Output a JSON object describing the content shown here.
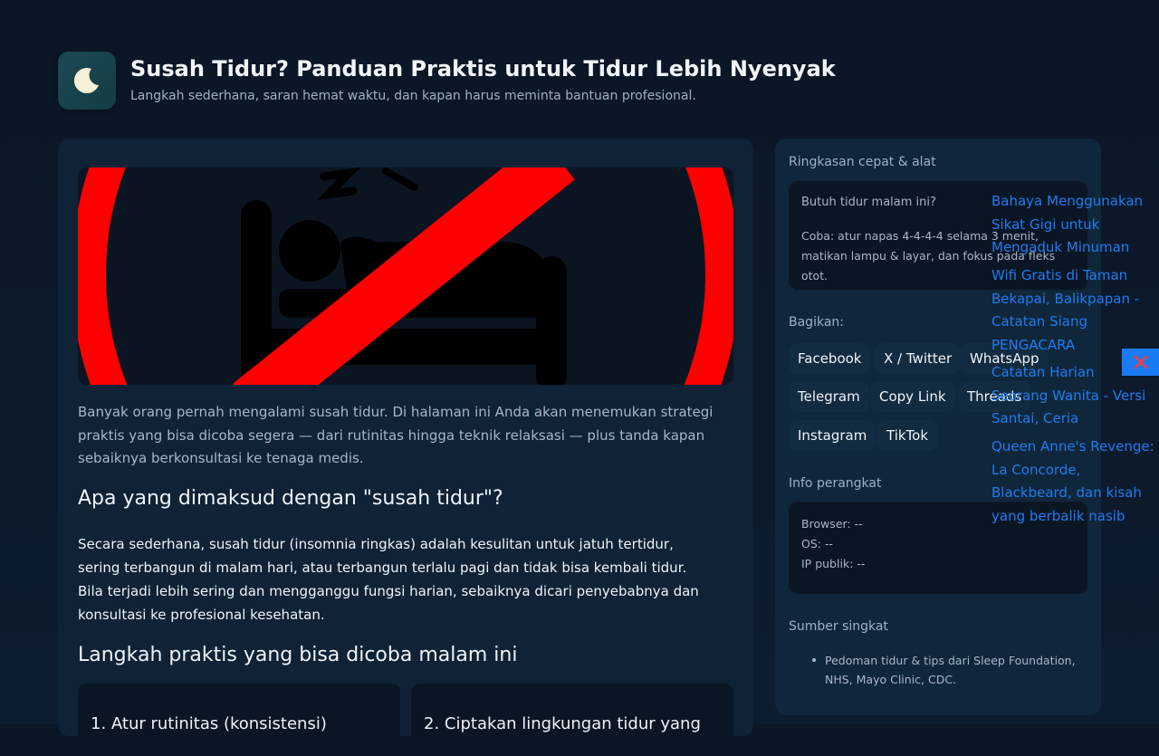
{
  "header": {
    "icon": "moon-icon",
    "title": "Susah Tidur? Panduan Praktis untuk Tidur Lebih Nyenyak",
    "subtitle": "Langkah sederhana, saran hemat waktu, dan kapan harus meminta bantuan profesional."
  },
  "hero": {
    "icon": "no-sleep-icon",
    "color": "#ff0000"
  },
  "article": {
    "intro": "Banyak orang pernah mengalami susah tidur. Di halaman ini Anda akan menemukan strategi praktis yang bisa dicoba segera — dari rutinitas hingga teknik relaksasi — plus tanda kapan sebaiknya berkonsultasi ke tenaga medis.",
    "h_definition": "Apa yang dimaksud dengan \"susah tidur\"?",
    "definition": "Secara sederhana, susah tidur (insomnia ringkas) adalah kesulitan untuk jatuh tertidur, sering terbangun di malam hari, atau terbangun terlalu pagi dan tidak bisa kembali tidur. Bila terjadi lebih sering dan mengganggu fungsi harian, sebaiknya dicari penyebabnya dan konsultasi ke profesional kesehatan.",
    "h_steps": "Langkah praktis yang bisa dicoba malam ini",
    "steps": [
      "1. Atur rutinitas (konsistensi)",
      "2. Ciptakan lingkungan tidur yang"
    ]
  },
  "sidebar": {
    "summary_label": "Ringkasan cepat & alat",
    "tip_question": "Butuh tidur malam ini?",
    "tip_answer": "Coba: atur napas 4-4-4-4 selama 3 menit, matikan lampu & layar, dan fokus pada fleks otot.",
    "share_label": "Bagikan:",
    "share_buttons": [
      "Facebook",
      "X / Twitter",
      "WhatsApp",
      "Telegram",
      "Copy Link",
      "Threads",
      "Instagram",
      "TikTok"
    ],
    "device_label": "Info perangkat",
    "device": {
      "browser": "Browser: --",
      "os": "OS: --",
      "ip": "IP publik: --"
    },
    "sources_label": "Sumber singkat",
    "sources": [
      "Pedoman tidur & tips dari Sleep Foundation, NHS, Mayo Clinic, CDC."
    ]
  },
  "related_links": [
    "Bahaya Menggunakan Sikat Gigi untuk Mengaduk Minuman",
    "Wifi Gratis di Taman Bekapai, Balikpapan - Catatan Siang PENGACARA",
    "Catatan Harian Seorang Wanita - Versi Santai, Ceria",
    "Queen Anne's Revenge: La Concorde, Blackbeard, dan kisah yang berbalik nasib"
  ],
  "overlay": {
    "close_icon": "close-icon",
    "accent": "#1a7cf5"
  }
}
